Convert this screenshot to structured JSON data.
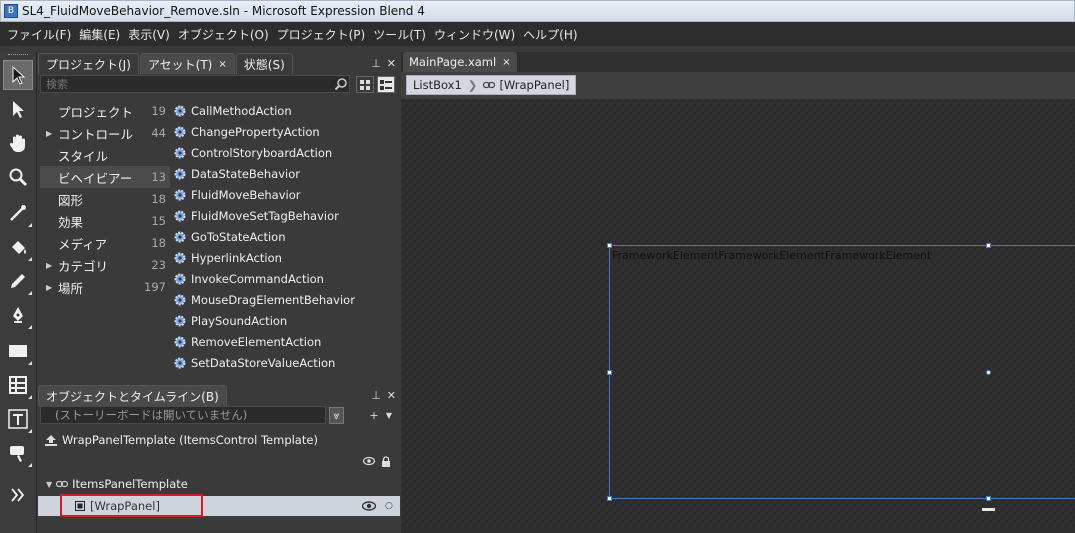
{
  "window": {
    "title": "SL4_FluidMoveBehavior_Remove.sln - Microsoft Expression Blend 4",
    "icon": "blend-app-icon"
  },
  "menu": [
    "ファイル(F)",
    "編集(E)",
    "表示(V)",
    "オブジェクト(O)",
    "プロジェクト(P)",
    "ツール(T)",
    "ウィンドウ(W)",
    "ヘルプ(H)"
  ],
  "toolbox": {
    "tools": [
      "selection-tool",
      "direct-selection-tool",
      "pan-tool",
      "zoom-tool",
      "eyedropper-tool",
      "paint-bucket-tool",
      "brush-tool",
      "pen-tool",
      "rectangle-tool",
      "grid-tool",
      "text-tool",
      "assets-tool",
      "expand-tool"
    ],
    "active": "selection-tool"
  },
  "tabs": [
    {
      "label": "プロジェクト(J)",
      "active": false
    },
    {
      "label": "アセット(T)",
      "active": true
    },
    {
      "label": "状態(S)",
      "active": false
    }
  ],
  "assets_panel": {
    "search_placeholder": "検索",
    "categories": [
      {
        "label": "プロジェクト",
        "count": "19",
        "expandable": false
      },
      {
        "label": "コントロール",
        "count": "44",
        "expandable": true
      },
      {
        "label": "スタイル",
        "count": "",
        "expandable": false
      },
      {
        "label": "ビヘイビアー",
        "count": "13",
        "expandable": false,
        "selected": true
      },
      {
        "label": "図形",
        "count": "18",
        "expandable": false
      },
      {
        "label": "効果",
        "count": "15",
        "expandable": false
      },
      {
        "label": "メディア",
        "count": "18",
        "expandable": false
      },
      {
        "label": "カテゴリ",
        "count": "23",
        "expandable": true
      },
      {
        "label": "場所",
        "count": "197",
        "expandable": true
      }
    ],
    "items": [
      "CallMethodAction",
      "ChangePropertyAction",
      "ControlStoryboardAction",
      "DataStateBehavior",
      "FluidMoveBehavior",
      "FluidMoveSetTagBehavior",
      "GoToStateAction",
      "HyperlinkAction",
      "InvokeCommandAction",
      "MouseDragElementBehavior",
      "PlaySoundAction",
      "RemoveElementAction",
      "SetDataStoreValueAction"
    ]
  },
  "objects_panel": {
    "title": "オブジェクトとタイムライン(B)",
    "storyboard": "(ストーリーボードは開いていません)",
    "template_root": "WrapPanelTemplate (ItemsControl Template)",
    "items_panel": "ItemsPanelTemplate",
    "selected_node": "[WrapPanel]"
  },
  "document": {
    "tab_label": "MainPage.xaml",
    "breadcrumb": [
      "ListBox1",
      "[WrapPanel]"
    ],
    "canvas_text": "FrameworkElementFrameworkElementFrameworkElement"
  },
  "colors": {
    "highlight_box": "#d21e1e",
    "selection_border": "#4a78c8"
  }
}
